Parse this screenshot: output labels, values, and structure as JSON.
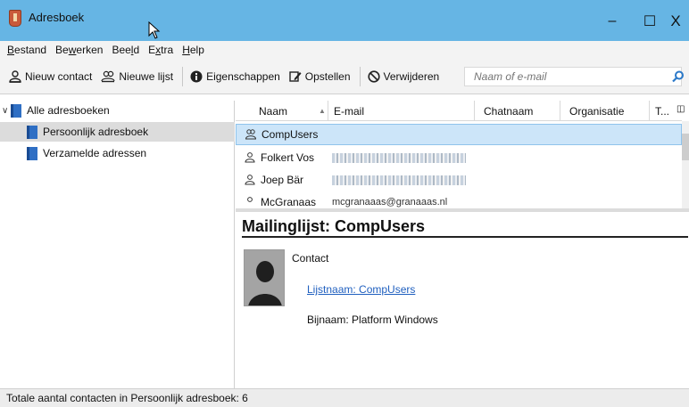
{
  "window": {
    "title": "Adresboek",
    "controls": {
      "minimize": "–",
      "maximize": "☐",
      "close": "X"
    }
  },
  "menubar": [
    {
      "before": "",
      "key": "B",
      "after": "estand"
    },
    {
      "before": "Be",
      "key": "w",
      "after": "erken"
    },
    {
      "before": "Bee",
      "key": "l",
      "after": "d"
    },
    {
      "before": "E",
      "key": "x",
      "after": "tra"
    },
    {
      "before": "",
      "key": "H",
      "after": "elp"
    }
  ],
  "toolbar": {
    "new_contact": "Nieuw contact",
    "new_list": "Nieuwe lijst",
    "properties": "Eigenschappen",
    "compose": "Opstellen",
    "delete": "Verwijderen",
    "search_placeholder": "Naam of e-mail"
  },
  "sidebar": {
    "root": "Alle adresboeken",
    "items": [
      "Persoonlijk adresboek",
      "Verzamelde adressen"
    ],
    "selected_index": 0
  },
  "contacts_list": {
    "columns": [
      "Naam",
      "E-mail",
      "Chatnaam",
      "Organisatie",
      "T..."
    ],
    "sort_column": "Naam",
    "rows": [
      {
        "name": "CompUsers",
        "type": "list",
        "selected": true
      },
      {
        "name": "Folkert Vos",
        "type": "person"
      },
      {
        "name": "Joep Bär",
        "type": "person"
      },
      {
        "name": "McGranaas",
        "email": "mcgranaaas@granaaas.nl",
        "type": "person"
      }
    ]
  },
  "details": {
    "heading": "Mailinglijst: CompUsers",
    "contact_label": "Contact",
    "list_name": "Lijstnaam: CompUsers",
    "nickname": "Bijnaam: Platform Windows"
  },
  "status": {
    "text": "Totale aantal contacten in Persoonlijk adresboek: 6"
  },
  "colors": {
    "titlebar": "#66b5e4",
    "selection": "#cce5f9",
    "link": "#1f5fbf"
  }
}
